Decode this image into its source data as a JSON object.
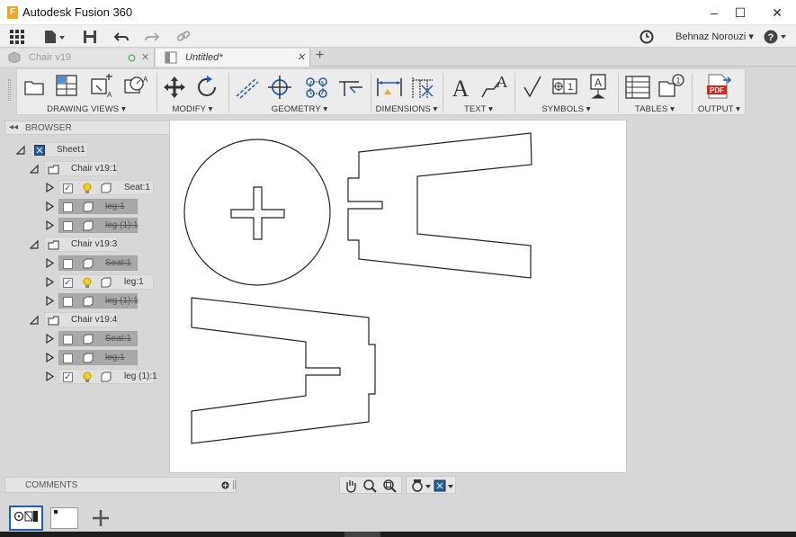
{
  "window": {
    "title": "Autodesk Fusion 360",
    "logo_letter": "F",
    "controls": [
      "–",
      "☐",
      "✕"
    ]
  },
  "qat": {
    "user": "Behnaz Norouzi ▾",
    "help": "?"
  },
  "tabs": [
    {
      "label": "Chair v19",
      "active": false
    },
    {
      "label": "Untitled*",
      "active": true
    }
  ],
  "ribbon": {
    "groups": [
      {
        "label": "DRAWING VIEWS ▾"
      },
      {
        "label": "MODIFY ▾"
      },
      {
        "label": "GEOMETRY ▾"
      },
      {
        "label": "DIMENSIONS ▾"
      },
      {
        "label": "TEXT ▾"
      },
      {
        "label": "SYMBOLS ▾"
      },
      {
        "label": "TABLES ▾"
      },
      {
        "label": "OUTPUT ▾"
      }
    ],
    "pdf_label": "PDF"
  },
  "browser": {
    "title": "BROWSER",
    "sheet": "Sheet1",
    "views": [
      {
        "label": "Chair v19:1",
        "items": [
          {
            "label": "Seat:1",
            "visible": true
          },
          {
            "label": "leg:1",
            "visible": false
          },
          {
            "label": "leg (1):1",
            "visible": false
          }
        ]
      },
      {
        "label": "Chair v19:3",
        "items": [
          {
            "label": "Seat:1",
            "visible": false
          },
          {
            "label": "leg:1",
            "visible": true
          },
          {
            "label": "leg (1):1",
            "visible": false
          }
        ]
      },
      {
        "label": "Chair v19:4",
        "items": [
          {
            "label": "Seat:1",
            "visible": false
          },
          {
            "label": "leg:1",
            "visible": false
          },
          {
            "label": "leg (1):1",
            "visible": true
          }
        ]
      }
    ]
  },
  "comments": {
    "title": "COMMENTS"
  },
  "colors": {
    "accent": "#1a5fb4",
    "pdf_red": "#d9261c",
    "logo_orange": "#f5a623"
  }
}
